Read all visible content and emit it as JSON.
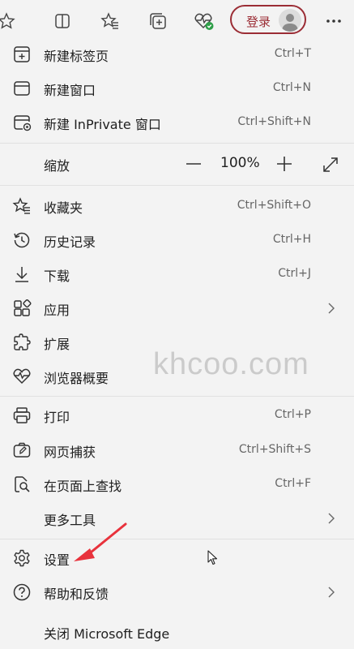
{
  "toolbar": {
    "signin_label": "登录",
    "icons": [
      "favorites-star-icon",
      "split-screen-icon",
      "favorites-icon",
      "collections-icon",
      "browser-essentials-icon",
      "more-options-icon"
    ]
  },
  "menu": {
    "new_tab": {
      "label": "新建标签页",
      "shortcut": "Ctrl+T"
    },
    "new_window": {
      "label": "新建窗口",
      "shortcut": "Ctrl+N"
    },
    "new_inprivate": {
      "label": "新建 InPrivate 窗口",
      "shortcut": "Ctrl+Shift+N"
    },
    "zoom": {
      "label": "缩放",
      "minus": "—",
      "value": "100%",
      "plus": "+"
    },
    "favorites": {
      "label": "收藏夹",
      "shortcut": "Ctrl+Shift+O"
    },
    "history": {
      "label": "历史记录",
      "shortcut": "Ctrl+H"
    },
    "downloads": {
      "label": "下载",
      "shortcut": "Ctrl+J"
    },
    "apps": {
      "label": "应用"
    },
    "extensions": {
      "label": "扩展"
    },
    "browser_essentials": {
      "label": "浏览器概要"
    },
    "print": {
      "label": "打印",
      "shortcut": "Ctrl+P"
    },
    "web_capture": {
      "label": "网页捕获",
      "shortcut": "Ctrl+Shift+S"
    },
    "find_on_page": {
      "label": "在页面上查找",
      "shortcut": "Ctrl+F"
    },
    "more_tools": {
      "label": "更多工具"
    },
    "settings": {
      "label": "设置"
    },
    "help_feedback": {
      "label": "帮助和反馈"
    },
    "close_edge": {
      "label": "关闭 Microsoft Edge"
    }
  },
  "watermark": "khcoo.com",
  "colors": {
    "accent": "#9b2d35",
    "arrow": "#e8323c",
    "status_green": "#2e9e48"
  }
}
